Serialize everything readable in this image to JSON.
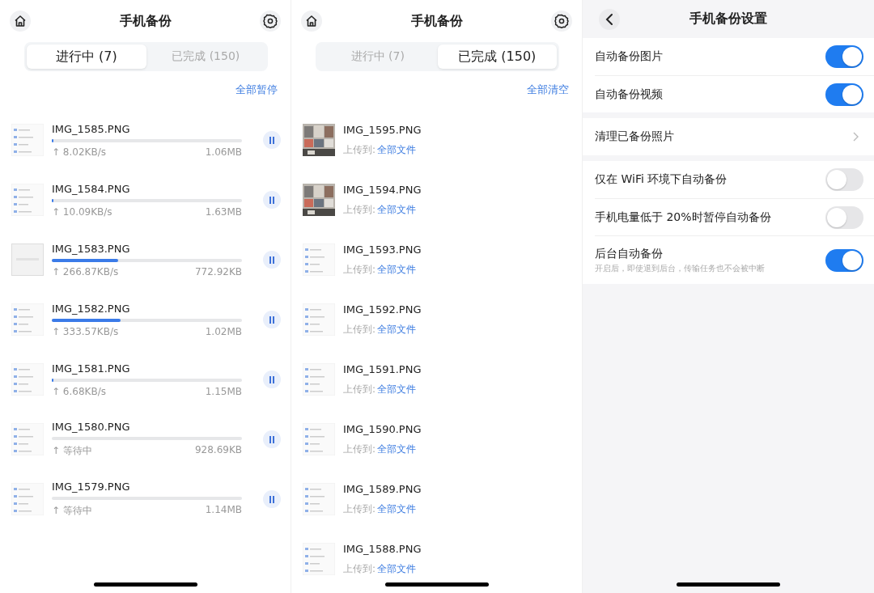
{
  "transfer_panels": [
    {
      "title": "手机备份",
      "tabs": [
        {
          "label": "进行中 (7)",
          "selected": true
        },
        {
          "label": "已完成 (150)",
          "selected": false
        }
      ],
      "action": "全部暂停",
      "files": [
        {
          "kind": "uploading",
          "name": "IMG_1585.PNG",
          "level": 0.01,
          "speed": "↑ 8.02KB/s",
          "size": "1.06MB"
        },
        {
          "kind": "uploading",
          "name": "IMG_1584.PNG",
          "level": 0.01,
          "speed": "↑ 10.09KB/s",
          "size": "1.63MB"
        },
        {
          "kind": "uploading",
          "name": "IMG_1583.PNG",
          "level": 0.35,
          "speed": "↑ 266.87KB/s",
          "size": "772.92KB"
        },
        {
          "kind": "uploading",
          "name": "IMG_1582.PNG",
          "level": 0.36,
          "speed": "↑ 333.57KB/s",
          "size": "1.02MB"
        },
        {
          "kind": "uploading",
          "name": "IMG_1581.PNG",
          "level": 0.01,
          "speed": "↑ 6.68KB/s",
          "size": "1.15MB"
        },
        {
          "kind": "uploading",
          "name": "IMG_1580.PNG",
          "speed": "↑ 等待中",
          "size": "928.69KB"
        },
        {
          "kind": "uploading",
          "name": "IMG_1579.PNG",
          "speed": "↑ 等待中",
          "size": "1.14MB"
        }
      ]
    },
    {
      "title": "手机备份",
      "tabs": [
        {
          "label": "进行中 (7)",
          "selected": false
        },
        {
          "label": "已完成 (150)",
          "selected": true
        }
      ],
      "action": "全部清空",
      "files": [
        {
          "kind": "done",
          "name": "IMG_1595.PNG",
          "upload_label": "上传到:",
          "destination": "全部文件"
        },
        {
          "kind": "done",
          "name": "IMG_1594.PNG",
          "upload_label": "上传到:",
          "destination": "全部文件"
        },
        {
          "kind": "done",
          "name": "IMG_1593.PNG",
          "upload_label": "上传到:",
          "destination": "全部文件"
        },
        {
          "kind": "done",
          "name": "IMG_1592.PNG",
          "upload_label": "上传到:",
          "destination": "全部文件"
        },
        {
          "kind": "done",
          "name": "IMG_1591.PNG",
          "upload_label": "上传到:",
          "destination": "全部文件"
        },
        {
          "kind": "done",
          "name": "IMG_1590.PNG",
          "upload_label": "上传到:",
          "destination": "全部文件"
        },
        {
          "kind": "done",
          "name": "IMG_1589.PNG",
          "upload_label": "上传到:",
          "destination": "全部文件"
        },
        {
          "kind": "done",
          "name": "IMG_1588.PNG",
          "upload_label": "上传到:",
          "destination": "全部文件"
        }
      ]
    }
  ],
  "settings": {
    "title": "手机备份设置",
    "groups": [
      [
        {
          "kind": "toggle",
          "label": "自动备份图片",
          "on": true
        },
        {
          "kind": "toggle",
          "label": "自动备份视频",
          "on": true
        }
      ],
      [
        {
          "kind": "link",
          "label": "清理已备份照片"
        }
      ],
      [
        {
          "kind": "toggle",
          "label": "仅在 WiFi 环境下自动备份",
          "on": false
        },
        {
          "kind": "toggle",
          "label": "手机电量低于 20%时暂停自动备份",
          "on": false
        },
        {
          "kind": "toggle",
          "label": "后台自动备份",
          "on": true,
          "description": "开启后，即使退到后台，传输任务也不会被中断"
        }
      ]
    ]
  }
}
